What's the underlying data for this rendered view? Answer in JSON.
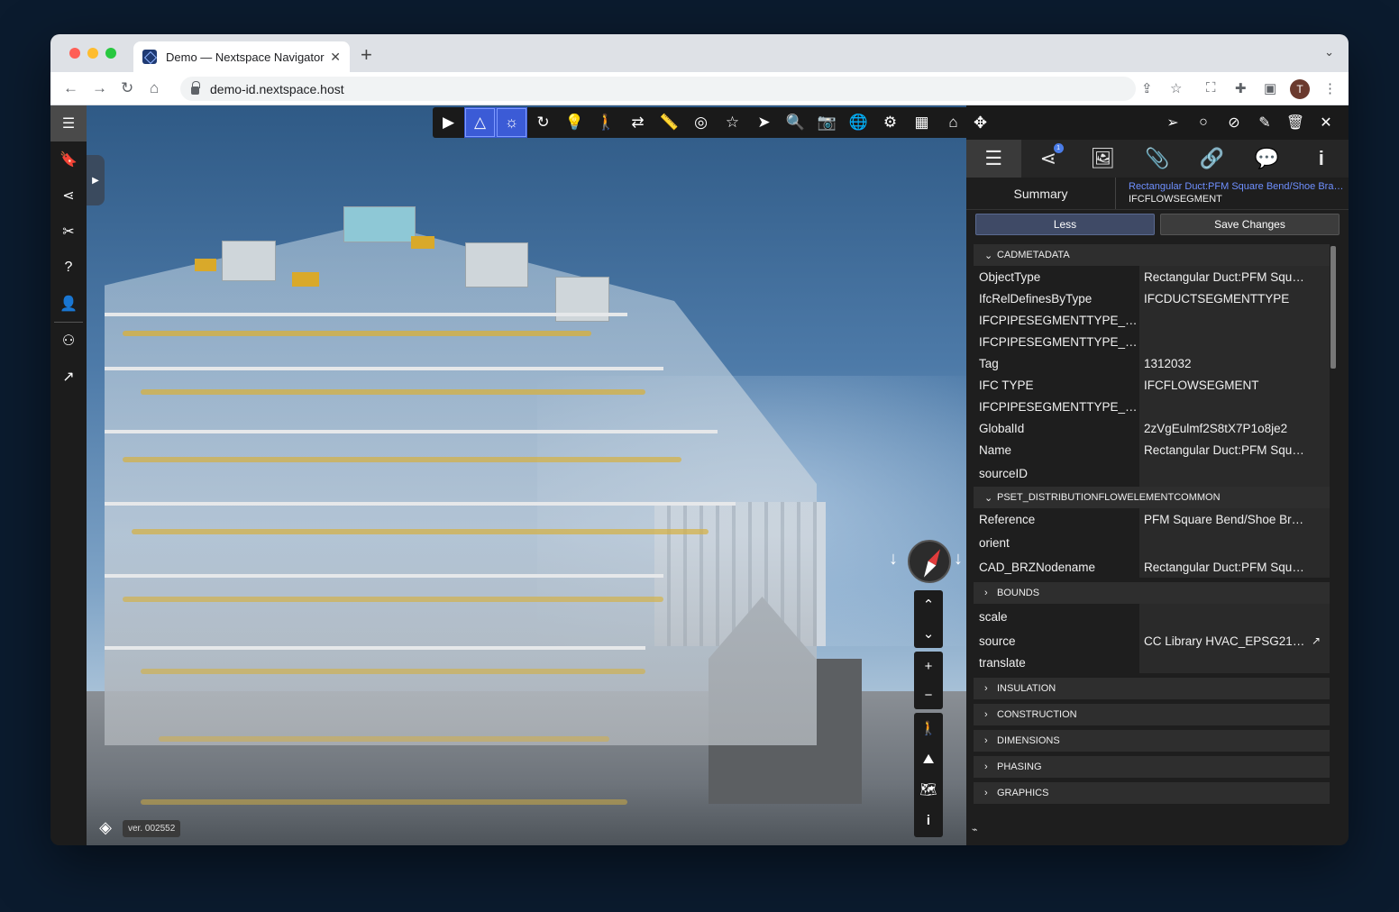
{
  "browser": {
    "tab_title": "Demo — Nextspace Navigator",
    "tab_close": "✕",
    "new_tab": "+",
    "url": "demo-id.nextspace.host",
    "profile_initial": "T"
  },
  "leftbar": {
    "items": [
      "menu",
      "bookmark",
      "share",
      "tools",
      "help",
      "user",
      "user-badge",
      "external-link"
    ]
  },
  "scene": {
    "version": "ver. 002552"
  },
  "toolbar": {
    "tools": [
      {
        "name": "play",
        "glyph": "▶"
      },
      {
        "name": "terrain",
        "glyph": "△",
        "active": true
      },
      {
        "name": "sun",
        "glyph": "☼",
        "active": true
      },
      {
        "name": "rotate",
        "glyph": "↻"
      },
      {
        "name": "lightbulb",
        "glyph": "💡"
      },
      {
        "name": "walk-person",
        "glyph": "🚶"
      },
      {
        "name": "swap",
        "glyph": "⇄"
      },
      {
        "name": "measure",
        "glyph": "📏"
      },
      {
        "name": "target",
        "glyph": "◎"
      },
      {
        "name": "star",
        "glyph": "☆"
      },
      {
        "name": "pointer",
        "glyph": "➤"
      },
      {
        "name": "zoom",
        "glyph": "🔍"
      },
      {
        "name": "camera",
        "glyph": "📷"
      },
      {
        "name": "globe",
        "glyph": "🌐"
      },
      {
        "name": "settings",
        "glyph": "⚙"
      },
      {
        "name": "grid",
        "glyph": "▦"
      },
      {
        "name": "home",
        "glyph": "⌂"
      },
      {
        "name": "help",
        "glyph": "?"
      }
    ]
  },
  "nav": {
    "buttons": [
      "⌃",
      "⌄",
      "+",
      "−",
      "🚶",
      "⛰",
      "🗺",
      "i"
    ]
  },
  "panel": {
    "top_icons": [
      "send-icon",
      "circle-icon",
      "eye-off-icon",
      "brush-icon",
      "trash-icon",
      "close-icon"
    ],
    "tabs": [
      "list",
      "share",
      "image",
      "attachment",
      "link",
      "comments",
      "info"
    ],
    "share_badge": "1",
    "summary_label": "Summary",
    "selected_name": "Rectangular Duct:PFM Square Bend/Shoe Bra…",
    "selected_type": "IFCFLOWSEGMENT",
    "less_label": "Less",
    "save_label": "Save Changes",
    "sections": [
      {
        "title": "CADMETADATA",
        "expanded": true,
        "rows": [
          {
            "k": "ObjectType",
            "v": "Rectangular Duct:PFM Squa…"
          },
          {
            "k": "IfcRelDefinesByType",
            "v": "IFCDUCTSEGMENTTYPE"
          },
          {
            "k": "IFCPIPESEGMENTTYPE_…",
            "v": ""
          },
          {
            "k": "IFCPIPESEGMENTTYPE_…",
            "v": ""
          },
          {
            "k": "Tag",
            "v": "1312032"
          },
          {
            "k": "IFC TYPE",
            "v": "IFCFLOWSEGMENT"
          },
          {
            "k": "IFCPIPESEGMENTTYPE_…",
            "v": ""
          },
          {
            "k": "GlobalId",
            "v": "2zVgEulmf2S8tX7P1o8je2"
          },
          {
            "k": "Name",
            "v": "Rectangular Duct:PFM Squa…"
          },
          {
            "k": "sourceID",
            "v": "",
            "tall": true
          }
        ]
      },
      {
        "title": "PSET_DISTRIBUTIONFLOWELEMENTCOMMON",
        "expanded": true,
        "rows": [
          {
            "k": "Reference",
            "v": "PFM Square Bend/Shoe Bra…"
          },
          {
            "k": "orient",
            "v": "",
            "tall": true
          },
          {
            "k": "CAD_BRZNodename",
            "v": "Rectangular Duct:PFM Squa…"
          }
        ]
      },
      {
        "title": "BOUNDS",
        "expanded": false,
        "rows": [
          {
            "k": "scale",
            "v": "",
            "tall": true
          },
          {
            "k": "source",
            "v": "CC Library HVAC_EPSG212…",
            "link": true
          },
          {
            "k": "translate",
            "v": ""
          }
        ]
      },
      {
        "title": "INSULATION",
        "expanded": false,
        "rows": []
      },
      {
        "title": "CONSTRUCTION",
        "expanded": false,
        "rows": []
      },
      {
        "title": "DIMENSIONS",
        "expanded": false,
        "rows": []
      },
      {
        "title": "PHASING",
        "expanded": false,
        "rows": []
      },
      {
        "title": "GRAPHICS",
        "expanded": false,
        "rows": []
      }
    ]
  }
}
